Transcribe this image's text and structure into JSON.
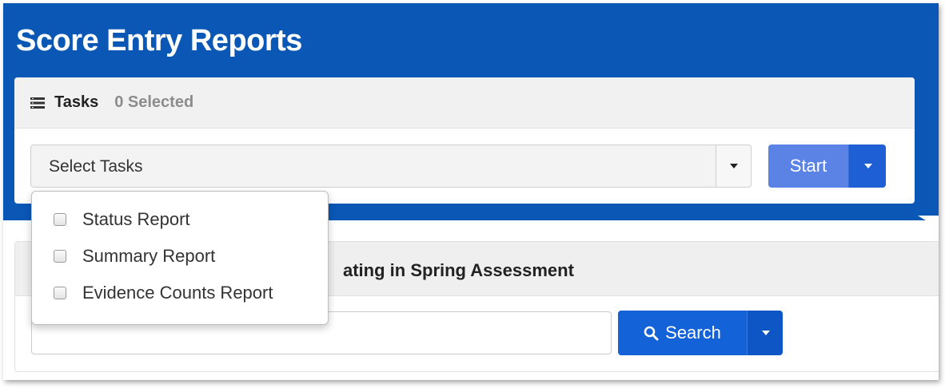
{
  "page": {
    "title": "Score Entry Reports"
  },
  "tasks_panel": {
    "heading": "Tasks",
    "selected_count": "0 Selected",
    "heading_icon": "list-icon",
    "select_placeholder": "Select Tasks",
    "start_label": "Start"
  },
  "task_options": [
    {
      "label": "Status Report",
      "checked": false
    },
    {
      "label": "Summary Report",
      "checked": false
    },
    {
      "label": "Evidence Counts Report",
      "checked": false
    }
  ],
  "search_panel": {
    "heading_visible_fragment": "ating in Spring Assessment",
    "search_value": "",
    "search_label": "Search",
    "search_icon": "search-icon"
  },
  "colors": {
    "header_blue": "#0a57b5",
    "start_button": "#5b83e6",
    "primary_button": "#1462d8"
  }
}
